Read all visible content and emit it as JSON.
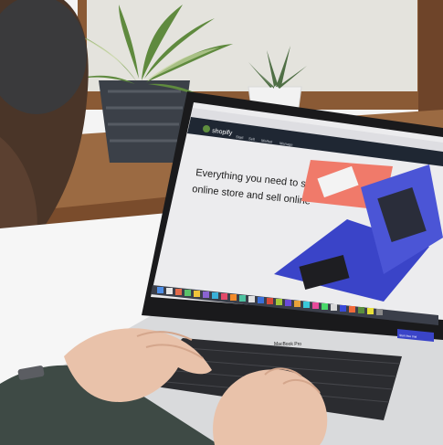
{
  "photo": {
    "screen_brand": "shopify",
    "screen_nav_items": [
      "Start",
      "Sell",
      "Market",
      "Manage"
    ],
    "screen_headline_line1": "Everything you need to start an",
    "screen_headline_line2": "online store and sell online",
    "screen_cta": "Start free trial",
    "laptop_label": "MacBook Pro",
    "colors": {
      "wall": "#f3f3f3",
      "window_frame": "#8a5a35",
      "sill": "#9b6a42",
      "screen_bg": "#ececee",
      "screen_nav": "#1f2733",
      "accent_blue": "#3a44c8",
      "accent_coral": "#f07a6a",
      "shopify_green": "#5e8e3e",
      "laptop_body": "#d9dadc",
      "keyboard": "#2b2c30",
      "sweater": "#3e4a45",
      "skin": "#e9c2aa",
      "hair": "#4a3528"
    }
  }
}
